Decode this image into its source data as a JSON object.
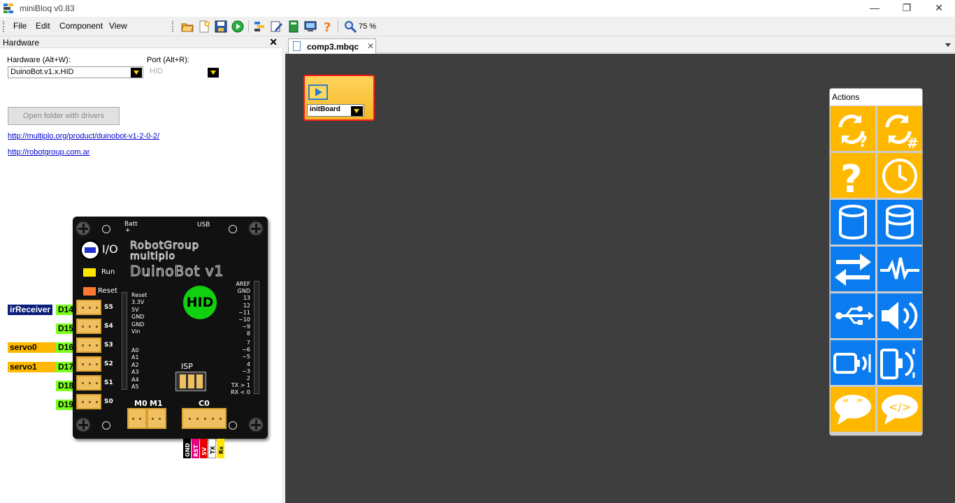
{
  "window": {
    "title": "miniBloq v0.83",
    "minimize_glyph": "—",
    "maximize_glyph": "❐",
    "close_glyph": "✕"
  },
  "menu": [
    "File",
    "Edit",
    "Component",
    "View"
  ],
  "toolbar": {
    "icons": [
      "open-folder-icon",
      "new-file-icon",
      "save-icon",
      "run-icon",
      "components-icon",
      "edit-icon",
      "book-icon",
      "serial-monitor-icon",
      "help-icon",
      "zoom-icon"
    ],
    "zoom_label": "75 %"
  },
  "hardware_panel": {
    "title": "Hardware",
    "close_glyph": "✕",
    "hardware_label": "Hardware (Alt+W):",
    "hardware_value": "DuinoBot.v1.x.HID",
    "port_label": "Port (Alt+R):",
    "port_value": "HID",
    "open_folder_label": "Open folder with drivers",
    "link1": "http://multiplo.org/product/duinobot-v1-2-0-2/",
    "link2": "http://robotgroup.com.ar"
  },
  "board": {
    "batt": "Batt",
    "plus": "+",
    "usb": "USB",
    "io": "I/O",
    "run": "Run",
    "reset": "Reset",
    "brand1": "RobotGroup",
    "brand2": "multiplo",
    "brand3": "DuinoBot v1",
    "hid": "HID",
    "isp": "ISP",
    "m0": "M0",
    "m1": "M1",
    "c0": "C0",
    "power_pins": [
      "Reset",
      "3.3V",
      "5V",
      "GND",
      "GND",
      "Vin"
    ],
    "analog_pins": [
      "A0",
      "A1",
      "A2",
      "A3",
      "A4",
      "A5"
    ],
    "digital_pins_top": [
      "AREF",
      "GND",
      "13",
      "12",
      "~11",
      "~10",
      "~9",
      "8"
    ],
    "digital_pins_bottom": [
      "7",
      "~6",
      "~5",
      "4",
      "~3",
      "2",
      "TX > 1",
      "RX < 0"
    ],
    "side_labels": [
      "S5",
      "S4",
      "S3",
      "S2",
      "S1",
      "S0"
    ],
    "c0_pins": [
      "GND",
      "RST",
      "5V",
      "TX",
      "Rx"
    ],
    "c0_colors": [
      "#000000",
      "#e6007e",
      "#e60000",
      "#ffffff",
      "#ffe600"
    ]
  },
  "ports": [
    {
      "var": "irReceiver",
      "pin": "D14",
      "var_color": "#0b1f7a"
    },
    {
      "var": "",
      "pin": "D15",
      "var_color": ""
    },
    {
      "var": "servo0",
      "pin": "D16",
      "var_color": "#ffb800"
    },
    {
      "var": "servo1",
      "pin": "D17",
      "var_color": "#ffb800"
    },
    {
      "var": "",
      "pin": "D18",
      "var_color": ""
    },
    {
      "var": "",
      "pin": "D19",
      "var_color": ""
    }
  ],
  "document": {
    "tab_label": "comp3.mbqc",
    "tab_close": "✕"
  },
  "init_block": {
    "value": "initBoard"
  },
  "actions_palette": {
    "title": "Actions",
    "tiles": [
      {
        "name": "while-icon",
        "color": "yellow"
      },
      {
        "name": "repeat-icon",
        "color": "yellow"
      },
      {
        "name": "if-icon",
        "color": "yellow"
      },
      {
        "name": "delay-icon",
        "color": "yellow"
      },
      {
        "name": "variable-icon",
        "color": "blue"
      },
      {
        "name": "variable-set-icon",
        "color": "blue"
      },
      {
        "name": "io-icon",
        "color": "blue"
      },
      {
        "name": "signal-icon",
        "color": "blue"
      },
      {
        "name": "usb-icon",
        "color": "blue"
      },
      {
        "name": "speaker-icon",
        "color": "blue"
      },
      {
        "name": "motor-icon",
        "color": "blue"
      },
      {
        "name": "servo-icon",
        "color": "blue"
      },
      {
        "name": "comment-icon",
        "color": "yellow"
      },
      {
        "name": "code-icon",
        "color": "yellow"
      }
    ]
  }
}
